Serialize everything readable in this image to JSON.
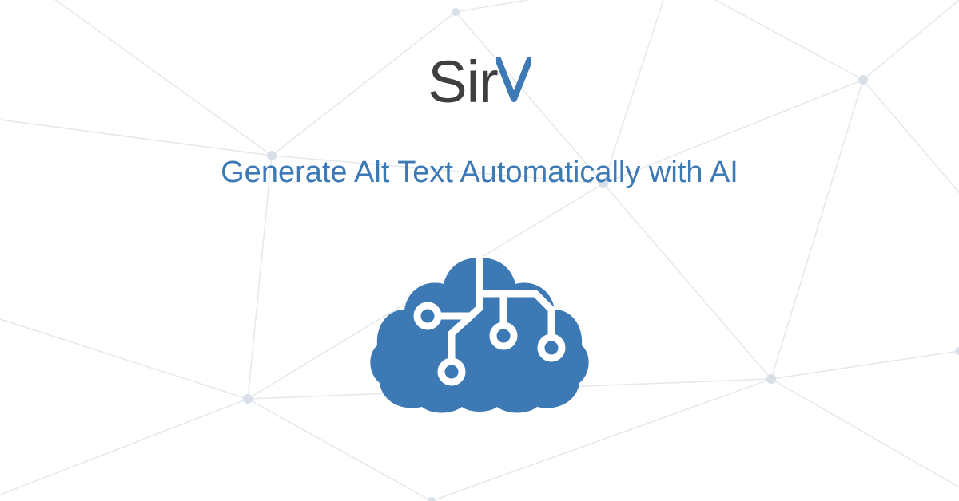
{
  "logo": {
    "part1": "Sir",
    "part2": "v"
  },
  "headline": "Generate Alt Text Automatically with AI",
  "colors": {
    "accent": "#3c79b5",
    "dark": "#3f3f3f",
    "network_line": "#e3e8ed",
    "network_node": "#d8dfe6"
  }
}
